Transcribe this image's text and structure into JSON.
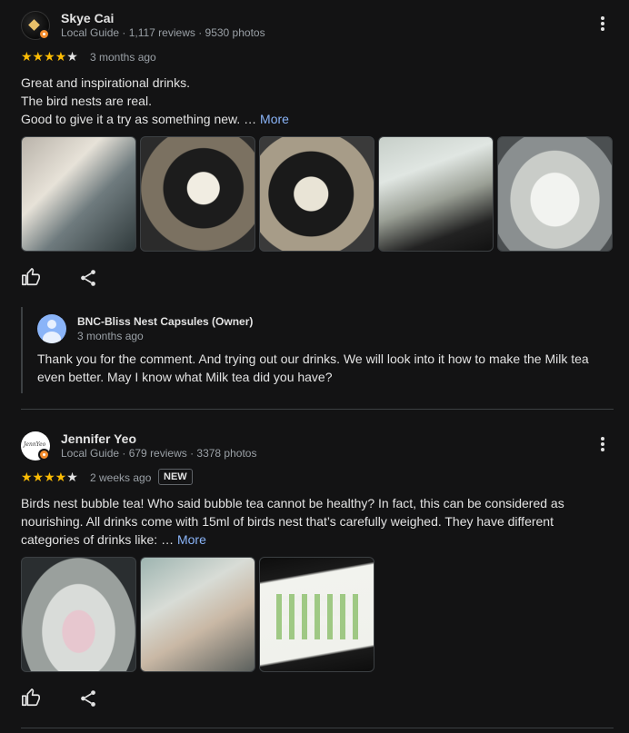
{
  "reviews": [
    {
      "author": "Skye Cai",
      "meta": "Local Guide · 1,117 reviews · 9530 photos",
      "rating": 4,
      "stars_text": "★★★★",
      "star_off_text": "★",
      "when": "3 months ago",
      "text_lines": [
        "Great and inspirational drinks.",
        "The bird nests are real.",
        "Good to give it a try as something new. …"
      ],
      "more_label": "More",
      "photos": [
        "photo-1",
        "photo-2",
        "photo-3",
        "photo-4",
        "photo-5"
      ],
      "owner_response": {
        "name": "BNC-Bliss Nest Capsules (Owner)",
        "when": "3 months ago",
        "text": "Thank you for the comment. And trying out our drinks. We will look into it how to make the Milk tea even better. May I know what Milk tea did you have?"
      }
    },
    {
      "author": "Jennifer Yeo",
      "meta": "Local Guide · 679 reviews · 3378 photos",
      "rating": 4,
      "stars_text": "★★★★",
      "star_off_text": "★",
      "when": "2 weeks ago",
      "badge": "NEW",
      "avatar_text": "JennYeo",
      "text": "Birds nest bubble tea! Who said bubble tea cannot be healthy? In fact, this can be considered as nourishing. All drinks come with 15ml of birds nest that’s carefully weighed. They have different categories of drinks like: …",
      "more_label": "More",
      "photos": [
        "photo-1",
        "photo-2",
        "photo-3"
      ]
    }
  ],
  "icons": {
    "like": "thumbs-up-icon",
    "share": "share-icon",
    "menu": "more-vert-icon"
  },
  "colors": {
    "background": "#131314",
    "star": "#fbbc04",
    "link": "#8ab4f8",
    "local_guide_badge": "#f28b2c"
  }
}
